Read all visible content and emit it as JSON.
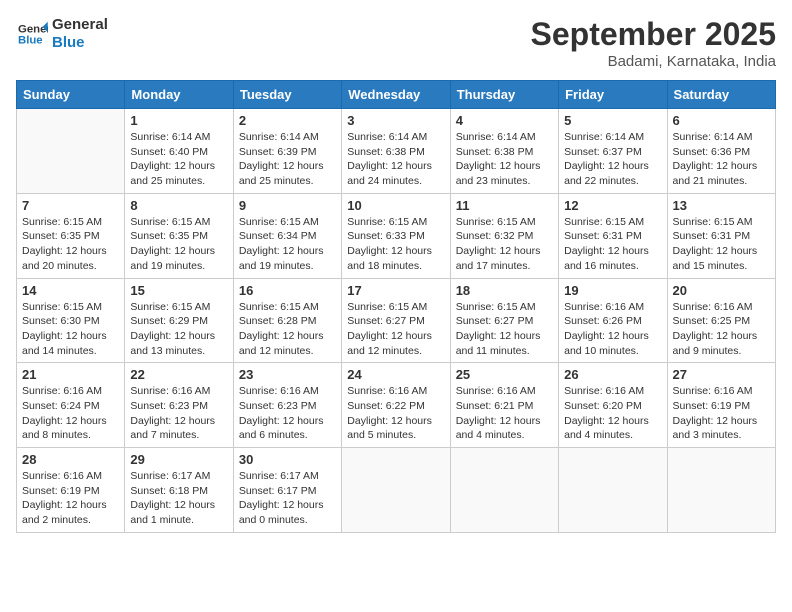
{
  "logo": {
    "line1": "General",
    "line2": "Blue"
  },
  "title": "September 2025",
  "subtitle": "Badami, Karnataka, India",
  "weekdays": [
    "Sunday",
    "Monday",
    "Tuesday",
    "Wednesday",
    "Thursday",
    "Friday",
    "Saturday"
  ],
  "weeks": [
    [
      {
        "day": "",
        "info": ""
      },
      {
        "day": "1",
        "info": "Sunrise: 6:14 AM\nSunset: 6:40 PM\nDaylight: 12 hours\nand 25 minutes."
      },
      {
        "day": "2",
        "info": "Sunrise: 6:14 AM\nSunset: 6:39 PM\nDaylight: 12 hours\nand 25 minutes."
      },
      {
        "day": "3",
        "info": "Sunrise: 6:14 AM\nSunset: 6:38 PM\nDaylight: 12 hours\nand 24 minutes."
      },
      {
        "day": "4",
        "info": "Sunrise: 6:14 AM\nSunset: 6:38 PM\nDaylight: 12 hours\nand 23 minutes."
      },
      {
        "day": "5",
        "info": "Sunrise: 6:14 AM\nSunset: 6:37 PM\nDaylight: 12 hours\nand 22 minutes."
      },
      {
        "day": "6",
        "info": "Sunrise: 6:14 AM\nSunset: 6:36 PM\nDaylight: 12 hours\nand 21 minutes."
      }
    ],
    [
      {
        "day": "7",
        "info": "Sunrise: 6:15 AM\nSunset: 6:35 PM\nDaylight: 12 hours\nand 20 minutes."
      },
      {
        "day": "8",
        "info": "Sunrise: 6:15 AM\nSunset: 6:35 PM\nDaylight: 12 hours\nand 19 minutes."
      },
      {
        "day": "9",
        "info": "Sunrise: 6:15 AM\nSunset: 6:34 PM\nDaylight: 12 hours\nand 19 minutes."
      },
      {
        "day": "10",
        "info": "Sunrise: 6:15 AM\nSunset: 6:33 PM\nDaylight: 12 hours\nand 18 minutes."
      },
      {
        "day": "11",
        "info": "Sunrise: 6:15 AM\nSunset: 6:32 PM\nDaylight: 12 hours\nand 17 minutes."
      },
      {
        "day": "12",
        "info": "Sunrise: 6:15 AM\nSunset: 6:31 PM\nDaylight: 12 hours\nand 16 minutes."
      },
      {
        "day": "13",
        "info": "Sunrise: 6:15 AM\nSunset: 6:31 PM\nDaylight: 12 hours\nand 15 minutes."
      }
    ],
    [
      {
        "day": "14",
        "info": "Sunrise: 6:15 AM\nSunset: 6:30 PM\nDaylight: 12 hours\nand 14 minutes."
      },
      {
        "day": "15",
        "info": "Sunrise: 6:15 AM\nSunset: 6:29 PM\nDaylight: 12 hours\nand 13 minutes."
      },
      {
        "day": "16",
        "info": "Sunrise: 6:15 AM\nSunset: 6:28 PM\nDaylight: 12 hours\nand 12 minutes."
      },
      {
        "day": "17",
        "info": "Sunrise: 6:15 AM\nSunset: 6:27 PM\nDaylight: 12 hours\nand 12 minutes."
      },
      {
        "day": "18",
        "info": "Sunrise: 6:15 AM\nSunset: 6:27 PM\nDaylight: 12 hours\nand 11 minutes."
      },
      {
        "day": "19",
        "info": "Sunrise: 6:16 AM\nSunset: 6:26 PM\nDaylight: 12 hours\nand 10 minutes."
      },
      {
        "day": "20",
        "info": "Sunrise: 6:16 AM\nSunset: 6:25 PM\nDaylight: 12 hours\nand 9 minutes."
      }
    ],
    [
      {
        "day": "21",
        "info": "Sunrise: 6:16 AM\nSunset: 6:24 PM\nDaylight: 12 hours\nand 8 minutes."
      },
      {
        "day": "22",
        "info": "Sunrise: 6:16 AM\nSunset: 6:23 PM\nDaylight: 12 hours\nand 7 minutes."
      },
      {
        "day": "23",
        "info": "Sunrise: 6:16 AM\nSunset: 6:23 PM\nDaylight: 12 hours\nand 6 minutes."
      },
      {
        "day": "24",
        "info": "Sunrise: 6:16 AM\nSunset: 6:22 PM\nDaylight: 12 hours\nand 5 minutes."
      },
      {
        "day": "25",
        "info": "Sunrise: 6:16 AM\nSunset: 6:21 PM\nDaylight: 12 hours\nand 4 minutes."
      },
      {
        "day": "26",
        "info": "Sunrise: 6:16 AM\nSunset: 6:20 PM\nDaylight: 12 hours\nand 4 minutes."
      },
      {
        "day": "27",
        "info": "Sunrise: 6:16 AM\nSunset: 6:19 PM\nDaylight: 12 hours\nand 3 minutes."
      }
    ],
    [
      {
        "day": "28",
        "info": "Sunrise: 6:16 AM\nSunset: 6:19 PM\nDaylight: 12 hours\nand 2 minutes."
      },
      {
        "day": "29",
        "info": "Sunrise: 6:17 AM\nSunset: 6:18 PM\nDaylight: 12 hours\nand 1 minute."
      },
      {
        "day": "30",
        "info": "Sunrise: 6:17 AM\nSunset: 6:17 PM\nDaylight: 12 hours\nand 0 minutes."
      },
      {
        "day": "",
        "info": ""
      },
      {
        "day": "",
        "info": ""
      },
      {
        "day": "",
        "info": ""
      },
      {
        "day": "",
        "info": ""
      }
    ]
  ]
}
